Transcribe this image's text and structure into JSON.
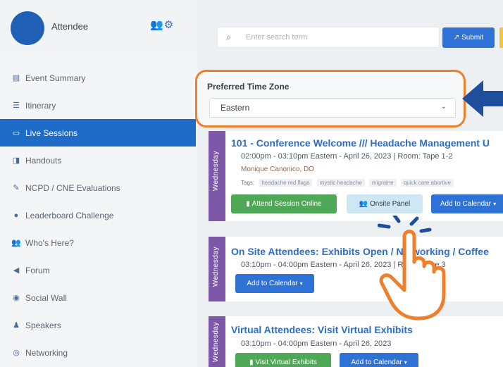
{
  "user": {
    "name": "Attendee",
    "icons": [
      "users-icon",
      "gear-icon"
    ]
  },
  "sidebar": {
    "items": [
      {
        "label": "Event Summary",
        "icon": "summary-icon",
        "glyph": "▤"
      },
      {
        "label": "Itinerary",
        "icon": "list-icon",
        "glyph": "☰"
      },
      {
        "label": "Live Sessions",
        "icon": "laptop-icon",
        "glyph": "▭",
        "active": true
      },
      {
        "label": "Handouts",
        "icon": "file-icon",
        "glyph": "◨"
      },
      {
        "label": "NCPD / CNE Evaluations",
        "icon": "edit-icon",
        "glyph": "✎"
      },
      {
        "label": "Leaderboard Challenge",
        "icon": "group-icon",
        "glyph": "●"
      },
      {
        "label": "Who's Here?",
        "icon": "users-icon",
        "glyph": "👥"
      },
      {
        "label": "Forum",
        "icon": "megaphone-icon",
        "glyph": "◀"
      },
      {
        "label": "Social Wall",
        "icon": "camera-icon",
        "glyph": "◉"
      },
      {
        "label": "Speakers",
        "icon": "person-icon",
        "glyph": "♟"
      },
      {
        "label": "Networking",
        "icon": "globe-icon",
        "glyph": "◎"
      }
    ]
  },
  "search": {
    "placeholder": "Enter search term",
    "submit_label": "Submit"
  },
  "timezone": {
    "label": "Preferred Time Zone",
    "value": "Eastern"
  },
  "sessions": [
    {
      "day": "Wednesday",
      "title": "101 - Conference Welcome /// Headache Management U",
      "time": "02:00pm - 03:10pm Eastern - April 26, 2023 | Room: Tape 1-2",
      "speaker": "Monique Canonico, DO",
      "tags_label": "Tags:",
      "tags": [
        "headache red flags",
        "mystic headache",
        "migraine",
        "quick care abortive"
      ],
      "buttons": {
        "attend": "Attend Session Online",
        "onsite": "Onsite Panel",
        "calendar": "Add to Calendar"
      }
    },
    {
      "day": "Wednesday",
      "title": "On Site Attendees: Exhibits Open / Networking / Coffee",
      "time": "03:10pm - 04:00pm Eastern - April 26, 2023 | Room: Tape 3",
      "buttons": {
        "calendar": "Add to Calendar"
      }
    },
    {
      "day": "Wednesday",
      "title": "Virtual Attendees: Visit Virtual Exhibits",
      "time": "03:10pm - 04:00pm Eastern - April 26, 2023",
      "buttons": {
        "visit": "Visit Virtual Exhibits",
        "calendar": "Add to Calendar"
      }
    }
  ],
  "colors": {
    "accent": "#1f6bc8",
    "highlight": "#f07f2b",
    "arrow": "#1f4f9c",
    "day_tab": "#7d57a8"
  }
}
